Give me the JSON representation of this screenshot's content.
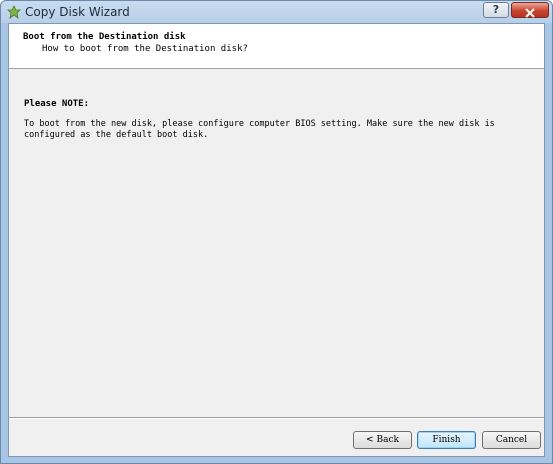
{
  "window": {
    "title": "Copy Disk Wizard",
    "help_label": "?",
    "close_label": "✕"
  },
  "header": {
    "title": "Boot from the Destination disk",
    "subtitle": "How to boot from the Destination disk?"
  },
  "content": {
    "note_title": "Please NOTE:",
    "note_body": "To boot from the new disk, please configure computer BIOS setting. Make sure the new disk is configured as the default boot disk."
  },
  "buttons": {
    "back_arrow": "<",
    "back_label": "Back",
    "finish_label": "Finish",
    "cancel_label": "Cancel"
  },
  "colors": {
    "titlebar": "#b7cfe9",
    "client_bg": "#f0f0f0",
    "close_button": "#c9432e"
  }
}
